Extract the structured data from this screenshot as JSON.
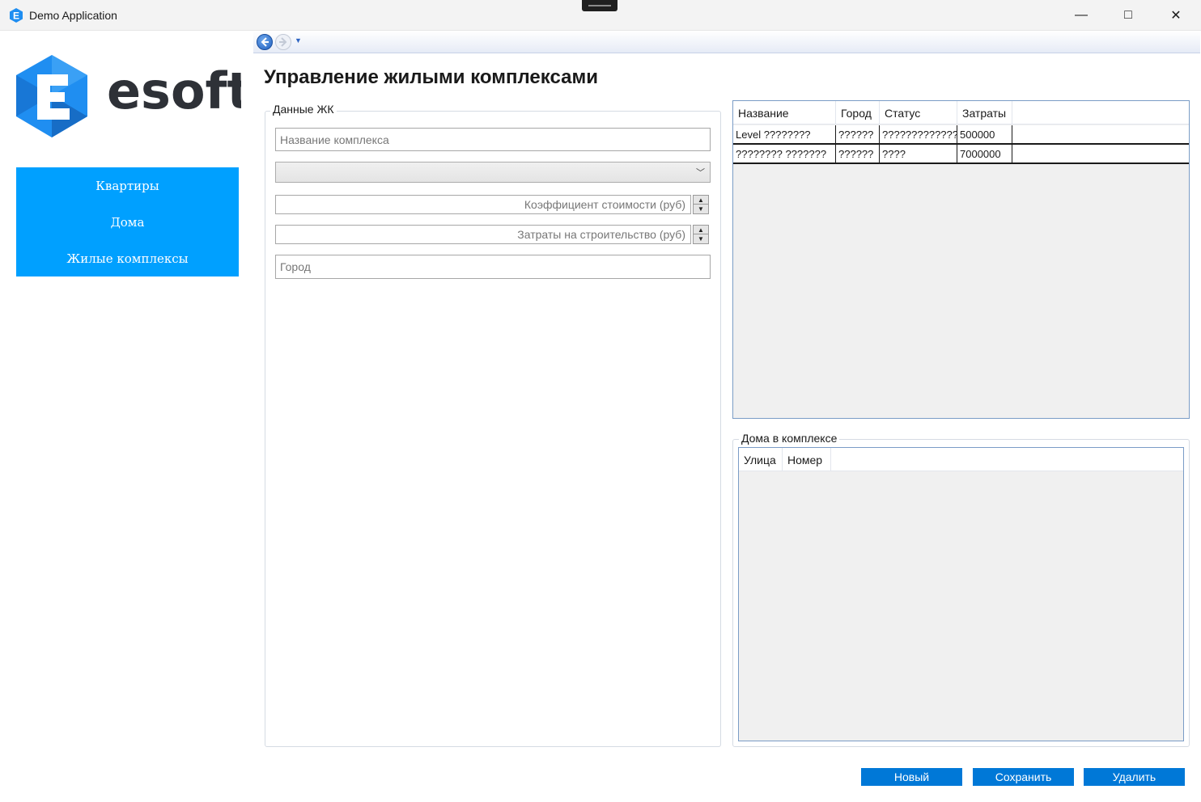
{
  "window": {
    "title": "Demo Application",
    "minimize": "—",
    "maximize": "□",
    "close": "✕",
    "icon": "esoft-app-icon"
  },
  "navigation": {
    "back_icon": "back-arrow-icon",
    "forward_icon": "forward-arrow-icon",
    "history_icon": "chevron-down-icon"
  },
  "logo": {
    "text": "esoft",
    "brand_color": "#1f8ef1",
    "text_color": "#2e3137"
  },
  "menu": {
    "color": "#00a0ff",
    "items": [
      {
        "label": "Квартиры"
      },
      {
        "label": "Дома"
      },
      {
        "label": "Жилые комплексы"
      }
    ]
  },
  "page": {
    "title": "Управление жилыми комплексами"
  },
  "form": {
    "group_label": "Данные ЖК",
    "name_placeholder": "Название комплекса",
    "status_value": "",
    "coefficient_placeholder": "Коэффициент стоимости (руб)",
    "costs_placeholder": "Затраты на строительство (руб)",
    "city_placeholder": "Город"
  },
  "complexes_table": {
    "columns": [
      "Название",
      "Город",
      "Статус",
      "Затраты"
    ],
    "rows": [
      [
        "Level ????????",
        "??????",
        "?????????????",
        "500000"
      ],
      [
        "???????? ???????",
        "??????",
        "????",
        "7000000"
      ]
    ]
  },
  "houses": {
    "group_label": "Дома в комплексе",
    "columns": [
      "Улица",
      "Номер"
    ],
    "rows": []
  },
  "actions": {
    "new_label": "Новый",
    "save_label": "Сохранить",
    "delete_label": "Удалить",
    "button_color": "#0078d7"
  }
}
